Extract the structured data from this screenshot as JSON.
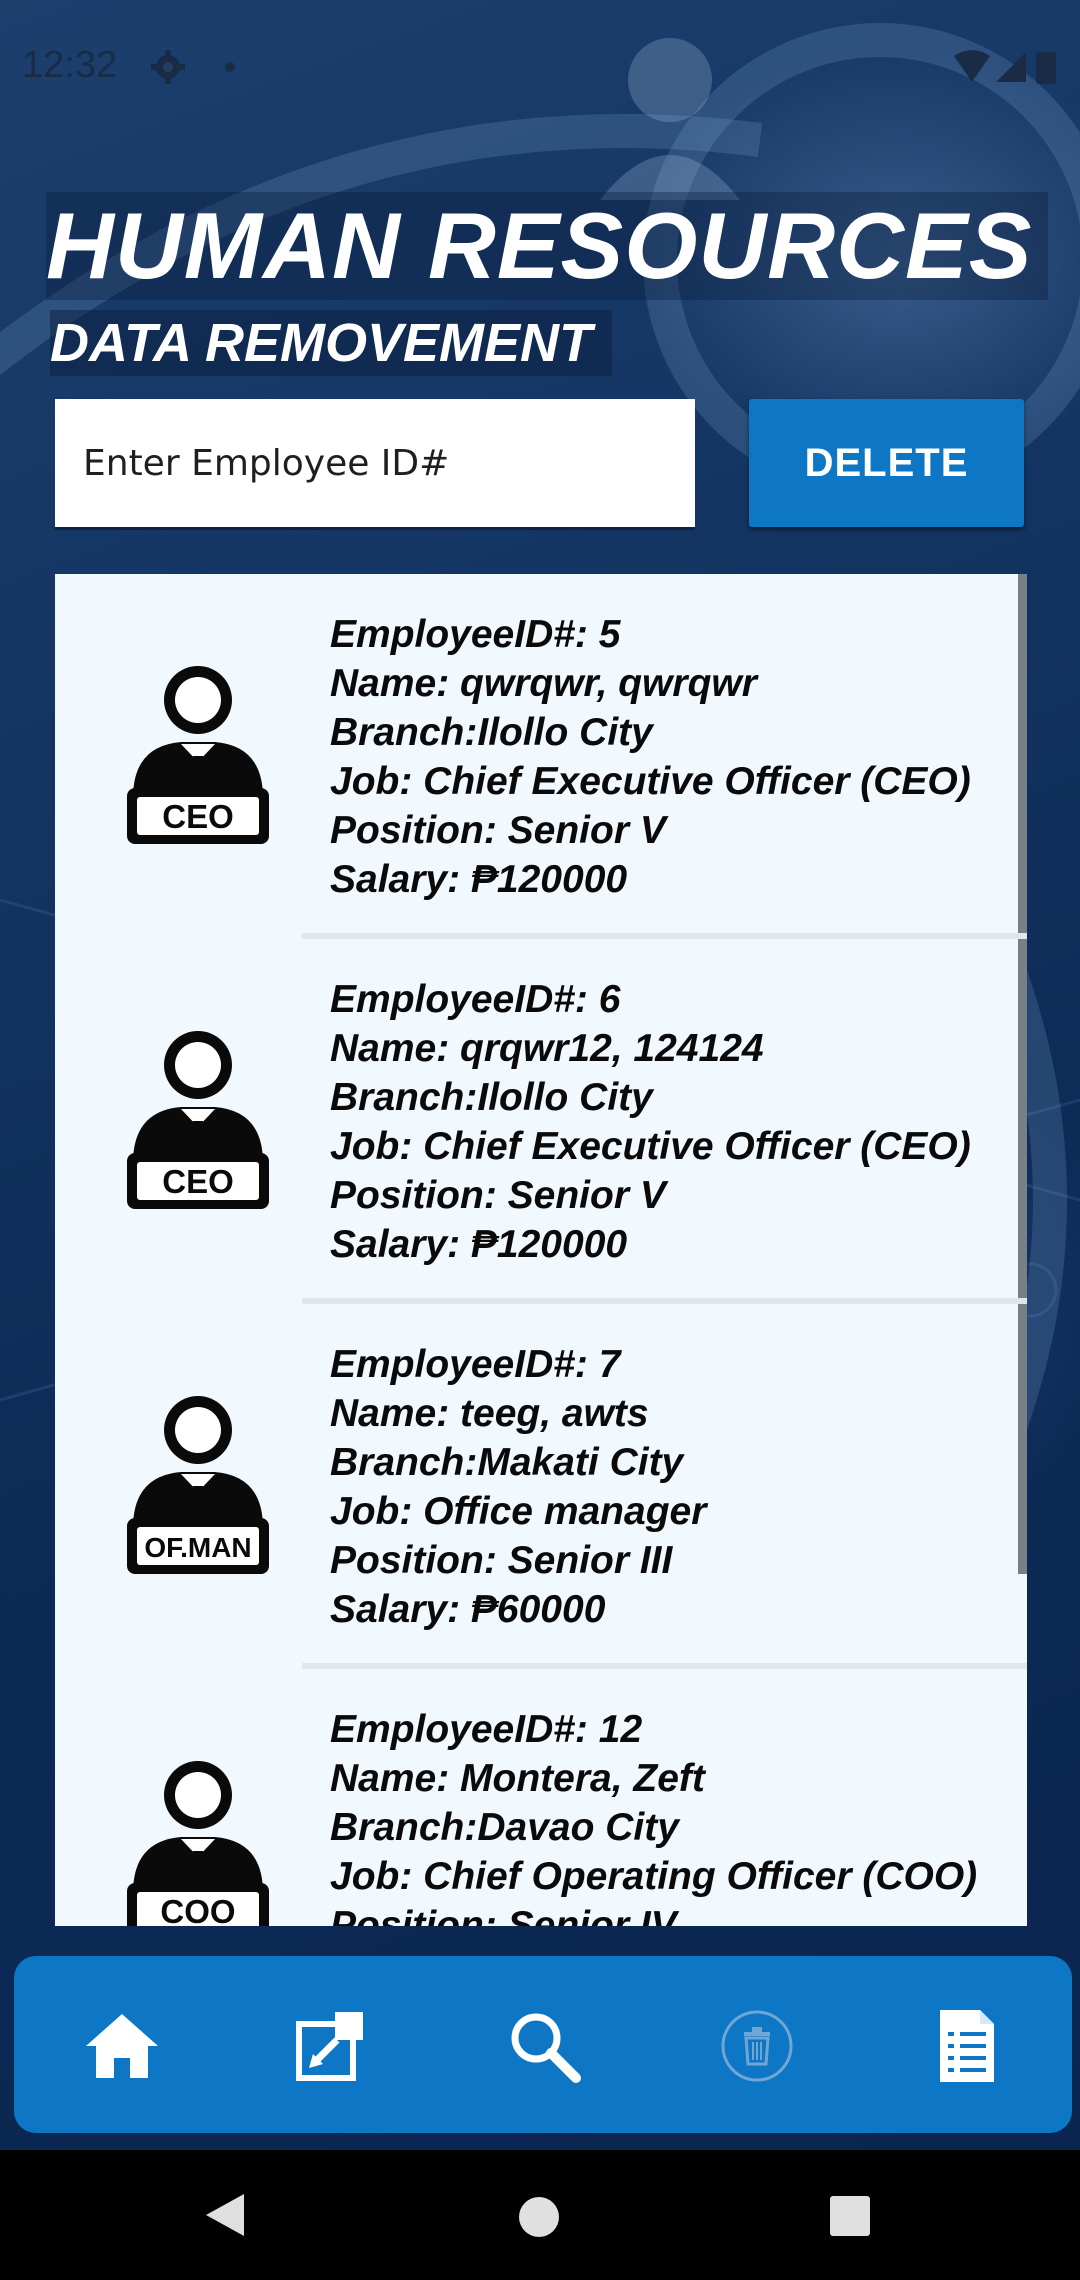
{
  "status": {
    "time": "12:32"
  },
  "header": {
    "title": "HUMAN RESOURCES",
    "subtitle": "DATA REMOVEMENT"
  },
  "search": {
    "placeholder": "Enter Employee ID#",
    "value": "",
    "button_label": "DELETE"
  },
  "employees": [
    {
      "id_line": "EmployeeID#: 5",
      "name_line": "Name: qwrqwr, qwrqwr",
      "branch_line": "Branch:Ilollo City",
      "job_line": "Job: Chief Executive Officer (CEO)",
      "position_line": "Position: Senior V",
      "salary_line": "Salary: ₱120000",
      "badge": "CEO"
    },
    {
      "id_line": "EmployeeID#: 6",
      "name_line": "Name: qrqwr12, 124124",
      "branch_line": "Branch:Ilollo City",
      "job_line": "Job: Chief Executive Officer (CEO)",
      "position_line": "Position: Senior V",
      "salary_line": "Salary: ₱120000",
      "badge": "CEO"
    },
    {
      "id_line": "EmployeeID#: 7",
      "name_line": "Name: teeg, awts",
      "branch_line": "Branch:Makati City",
      "job_line": "Job: Office manager",
      "position_line": "Position: Senior III",
      "salary_line": "Salary: ₱60000",
      "badge": "OF.MAN"
    },
    {
      "id_line": "EmployeeID#: 12",
      "name_line": "Name: Montera, Zeft",
      "branch_line": "Branch:Davao City",
      "job_line": "Job: Chief Operating Officer (COO)",
      "position_line": "Position: Senior IV",
      "salary_line": "",
      "badge": "COO"
    }
  ],
  "bottom_nav": {
    "items": [
      {
        "icon": "home-icon",
        "active": false
      },
      {
        "icon": "edit-icon",
        "active": false
      },
      {
        "icon": "search-icon",
        "active": false
      },
      {
        "icon": "trash-icon",
        "active": true
      },
      {
        "icon": "report-icon",
        "active": false
      }
    ]
  },
  "colors": {
    "accent": "#0d77c6",
    "list_bg": "#f1f8fe",
    "text": "#0a0a0a"
  }
}
